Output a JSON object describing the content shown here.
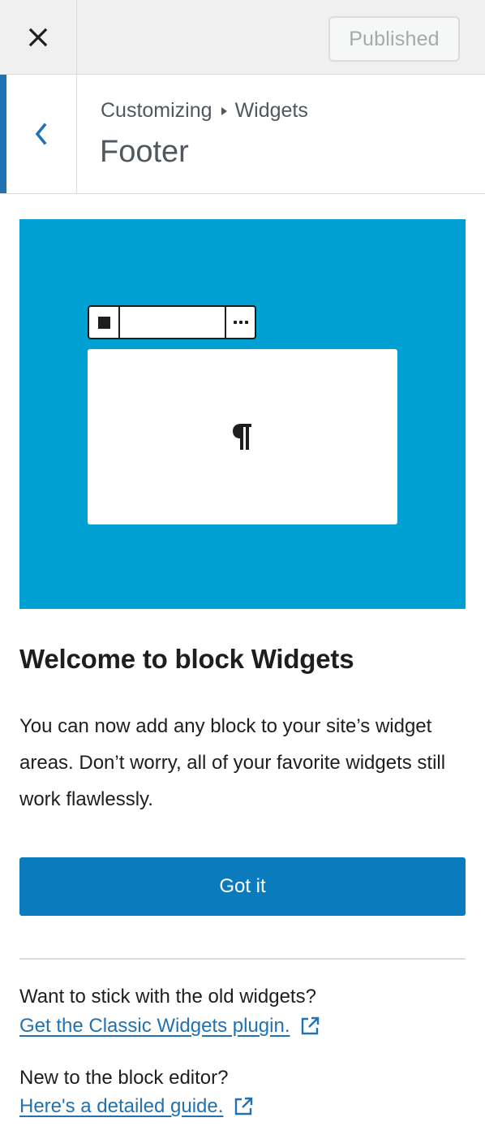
{
  "header": {
    "close_icon": "close-icon",
    "publish_label": "Published"
  },
  "section": {
    "back_icon": "chevron-left-icon",
    "breadcrumb": [
      "Customizing",
      "Widgets"
    ],
    "title": "Footer"
  },
  "welcome": {
    "illustration": {
      "background": "#00a0d2",
      "toolbar_icons": [
        "block-square-icon",
        "more-options-icon"
      ],
      "block_icon": "paragraph-icon"
    },
    "heading": "Welcome to block Widgets",
    "body": "You can now add any block to your site’s widget areas. Don’t worry, all of your favorite widgets still work flawlessly.",
    "button_label": "Got it"
  },
  "help": [
    {
      "text": "Want to stick with the old widgets?",
      "link": "Get the Classic Widgets plugin."
    },
    {
      "text": "New to the block editor?",
      "link": "Here's a detailed guide."
    }
  ],
  "colors": {
    "accent": "#2271b1",
    "button": "#0a7cbd",
    "illustration_bg": "#00a0d2"
  }
}
